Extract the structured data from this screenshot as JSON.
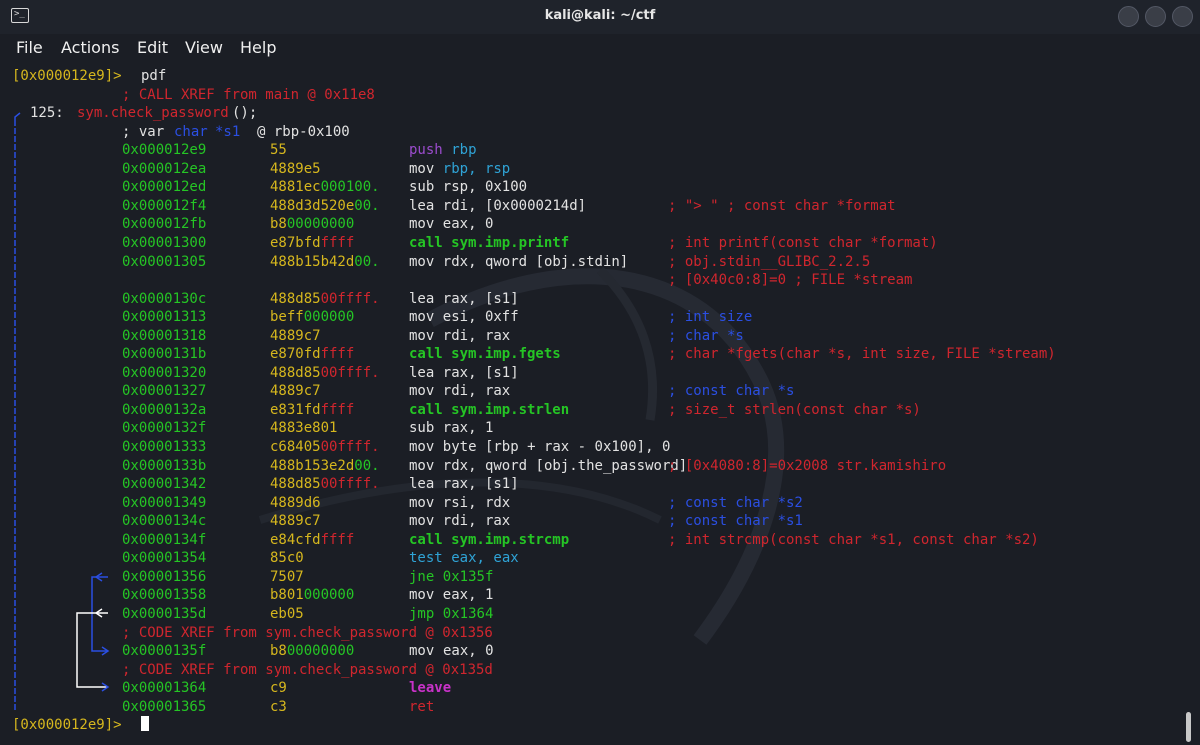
{
  "window": {
    "title": "kali@kali: ~/ctf"
  },
  "menu": [
    "File",
    "Actions",
    "Edit",
    "View",
    "Help"
  ],
  "colors": {
    "yellow": "#d6b71e",
    "red": "#d0262e",
    "green": "#25c525",
    "white": "#e2e2e2",
    "blue": "#2b4fe2",
    "cyan": "#2fa3d6",
    "magenta": "#c832c8",
    "purple": "#9b4ccd"
  },
  "terminal": {
    "prompt_line_1": {
      "prompt": "[0x000012e9]>",
      "command": "pdf"
    },
    "xref_main": "; CALL XREF from main @ 0x11e8",
    "func_header": {
      "size": "125:",
      "name": "sym.check_password",
      "suffix": "();"
    },
    "var_decl": {
      "kw": "; var",
      "type": "char",
      "name": "*s1",
      "loc": "@ rbp-0x100"
    },
    "instructions": [
      {
        "addr": "0x000012e9",
        "bytes": "55",
        "bytes_hl": "",
        "mnem": "push",
        "mnem_color": "purple",
        "ops": "rbp",
        "ops_color": "cyan",
        "comment": "",
        "comment_color": ""
      },
      {
        "addr": "0x000012ea",
        "bytes": "4889e5",
        "bytes_hl": "",
        "mnem": "mov",
        "mnem_color": "white",
        "ops": "rbp, rsp",
        "ops_color": "cyan",
        "comment": "",
        "comment_color": ""
      },
      {
        "addr": "0x000012ed",
        "bytes": "4881ec",
        "bytes_hl": "000100.",
        "mnem": "sub",
        "mnem_color": "white",
        "ops": "rsp, 0x100",
        "ops_color": "white",
        "comment": "",
        "comment_color": ""
      },
      {
        "addr": "0x000012f4",
        "bytes": "488d3d520e",
        "bytes_hl": "00.",
        "mnem": "lea",
        "mnem_color": "white",
        "ops": "rdi, [0x0000214d]",
        "ops_color": "white",
        "comment": "; \"> \" ; const char *format",
        "comment_color": "red"
      },
      {
        "addr": "0x000012fb",
        "bytes": "b8",
        "bytes_hl": "00000000",
        "mnem": "mov",
        "mnem_color": "white",
        "ops": "eax, 0",
        "ops_color": "white",
        "comment": "",
        "comment_color": ""
      },
      {
        "addr": "0x00001300",
        "bytes": "e87bfd",
        "bytes_hl": "ffff",
        "mnem": "call sym.imp.printf",
        "mnem_color": "green",
        "ops": "",
        "ops_color": "white",
        "comment": "; int printf(const char *format)",
        "comment_color": "red"
      },
      {
        "addr": "0x00001305",
        "bytes": "488b15b42d",
        "bytes_hl": "00.",
        "mnem": "mov",
        "mnem_color": "white",
        "ops": "rdx, qword [obj.stdin]",
        "ops_color": "white",
        "comment": "; obj.stdin__GLIBC_2.2.5",
        "comment_color": "red"
      },
      {
        "addr": "",
        "bytes": "",
        "bytes_hl": "",
        "mnem": "",
        "mnem_color": "white",
        "ops": "",
        "ops_color": "white",
        "comment": "; [0x40c0:8]=0 ; FILE *stream",
        "comment_color": "red"
      },
      {
        "addr": "0x0000130c",
        "bytes": "488d85",
        "bytes_hl": "00ffff.",
        "mnem": "lea",
        "mnem_color": "white",
        "ops": "rax, [s1]",
        "ops_color": "white",
        "comment": "",
        "comment_color": ""
      },
      {
        "addr": "0x00001313",
        "bytes": "beff",
        "bytes_hl": "000000",
        "mnem": "mov",
        "mnem_color": "white",
        "ops": "esi, 0xff",
        "ops_color": "white",
        "comment": "; int size",
        "comment_color": "blue"
      },
      {
        "addr": "0x00001318",
        "bytes": "4889c7",
        "bytes_hl": "",
        "mnem": "mov",
        "mnem_color": "white",
        "ops": "rdi, rax",
        "ops_color": "white",
        "comment": "; char *s",
        "comment_color": "blue"
      },
      {
        "addr": "0x0000131b",
        "bytes": "e870fd",
        "bytes_hl": "ffff",
        "mnem": "call sym.imp.fgets",
        "mnem_color": "green",
        "ops": "",
        "ops_color": "white",
        "comment": "; char *fgets(char *s, int size, FILE *stream)",
        "comment_color": "red"
      },
      {
        "addr": "0x00001320",
        "bytes": "488d85",
        "bytes_hl": "00ffff.",
        "mnem": "lea",
        "mnem_color": "white",
        "ops": "rax, [s1]",
        "ops_color": "white",
        "comment": "",
        "comment_color": ""
      },
      {
        "addr": "0x00001327",
        "bytes": "4889c7",
        "bytes_hl": "",
        "mnem": "mov",
        "mnem_color": "white",
        "ops": "rdi, rax",
        "ops_color": "white",
        "comment": "; const char *s",
        "comment_color": "blue"
      },
      {
        "addr": "0x0000132a",
        "bytes": "e831fd",
        "bytes_hl": "ffff",
        "mnem": "call sym.imp.strlen",
        "mnem_color": "green",
        "ops": "",
        "ops_color": "white",
        "comment": "; size_t strlen(const char *s)",
        "comment_color": "red"
      },
      {
        "addr": "0x0000132f",
        "bytes": "4883e801",
        "bytes_hl": "",
        "mnem": "sub",
        "mnem_color": "white",
        "ops": "rax, 1",
        "ops_color": "white",
        "comment": "",
        "comment_color": ""
      },
      {
        "addr": "0x00001333",
        "bytes": "c68405",
        "bytes_hl": "00ffff.",
        "mnem": "mov",
        "mnem_color": "white",
        "ops": "byte [rbp + rax - 0x100], 0",
        "ops_color": "white",
        "comment": "",
        "comment_color": ""
      },
      {
        "addr": "0x0000133b",
        "bytes": "488b153e2d",
        "bytes_hl": "00.",
        "mnem": "mov",
        "mnem_color": "white",
        "ops": "rdx, qword [obj.the_password]",
        "ops_color": "white",
        "comment": "; [0x4080:8]=0x2008 str.kamishiro",
        "comment_color": "red"
      },
      {
        "addr": "0x00001342",
        "bytes": "488d85",
        "bytes_hl": "00ffff.",
        "mnem": "lea",
        "mnem_color": "white",
        "ops": "rax, [s1]",
        "ops_color": "white",
        "comment": "",
        "comment_color": ""
      },
      {
        "addr": "0x00001349",
        "bytes": "4889d6",
        "bytes_hl": "",
        "mnem": "mov",
        "mnem_color": "white",
        "ops": "rsi, rdx",
        "ops_color": "white",
        "comment": "; const char *s2",
        "comment_color": "blue"
      },
      {
        "addr": "0x0000134c",
        "bytes": "4889c7",
        "bytes_hl": "",
        "mnem": "mov",
        "mnem_color": "white",
        "ops": "rdi, rax",
        "ops_color": "white",
        "comment": "; const char *s1",
        "comment_color": "blue"
      },
      {
        "addr": "0x0000134f",
        "bytes": "e84cfd",
        "bytes_hl": "ffff",
        "mnem": "call sym.imp.strcmp",
        "mnem_color": "green",
        "ops": "",
        "ops_color": "white",
        "comment": "; int strcmp(const char *s1, const char *s2)",
        "comment_color": "red"
      },
      {
        "addr": "0x00001354",
        "bytes": "85c0",
        "bytes_hl": "",
        "mnem": "test",
        "mnem_color": "cyan",
        "ops": "eax, eax",
        "ops_color": "cyan",
        "comment": "",
        "comment_color": ""
      },
      {
        "addr": "0x00001356",
        "bytes": "7507",
        "bytes_hl": "",
        "mnem": "jne",
        "mnem_color": "green",
        "ops": "0x135f",
        "ops_color": "green",
        "comment": "",
        "comment_color": ""
      },
      {
        "addr": "0x00001358",
        "bytes": "b801",
        "bytes_hl": "000000",
        "mnem": "mov",
        "mnem_color": "white",
        "ops": "eax, 1",
        "ops_color": "white",
        "comment": "",
        "comment_color": ""
      },
      {
        "addr": "0x0000135d",
        "bytes": "eb05",
        "bytes_hl": "",
        "mnem": "jmp",
        "mnem_color": "green",
        "ops": "0x1364",
        "ops_color": "green",
        "comment": "",
        "comment_color": ""
      }
    ],
    "xref_1": "; CODE XREF from sym.check_password @ 0x1356",
    "ins_135f": {
      "addr": "0x0000135f",
      "bytes": "b8",
      "bytes_hl": "00000000",
      "mnem": "mov",
      "ops": "eax, 0"
    },
    "xref_2": "; CODE XREF from sym.check_password @ 0x135d",
    "ins_1364": {
      "addr": "0x00001364",
      "bytes": "c9",
      "mnem": "leave"
    },
    "ins_1365": {
      "addr": "0x00001365",
      "bytes": "c3",
      "mnem": "ret"
    },
    "prompt_line_2": {
      "prompt": "[0x000012e9]>"
    }
  }
}
